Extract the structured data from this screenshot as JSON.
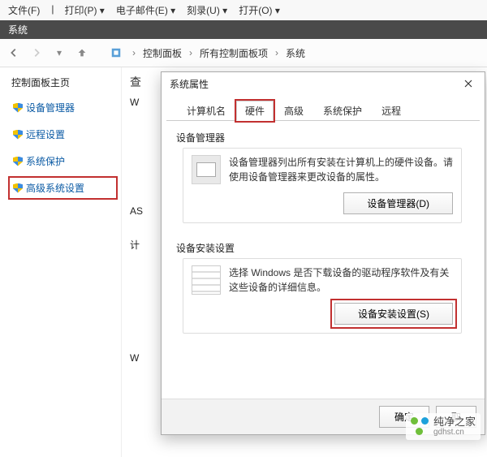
{
  "menubar": {
    "file": "文件(F)",
    "print": "打印(P)",
    "email": "电子邮件(E)",
    "burn": "刻录(U)",
    "open": "打开(O)"
  },
  "window": {
    "title": "系统"
  },
  "breadcrumb": {
    "root": "控制面板",
    "all": "所有控制面板项",
    "current": "系统"
  },
  "sidebar": {
    "title": "控制面板主页",
    "items": [
      {
        "label": "设备管理器"
      },
      {
        "label": "远程设置"
      },
      {
        "label": "系统保护"
      },
      {
        "label": "高级系统设置"
      }
    ]
  },
  "main": {
    "heading": "查",
    "stubs": [
      "W",
      "",
      "",
      "AS",
      "",
      "计",
      "",
      "W"
    ]
  },
  "dialog": {
    "title": "系统属性",
    "close": "×",
    "tabs": [
      {
        "label": "计算机名"
      },
      {
        "label": "硬件",
        "active": true,
        "highlight": true
      },
      {
        "label": "高级"
      },
      {
        "label": "系统保护"
      },
      {
        "label": "远程"
      }
    ],
    "groups": {
      "deviceManager": {
        "heading": "设备管理器",
        "desc": "设备管理器列出所有安装在计算机上的硬件设备。请使用设备管理器来更改设备的属性。",
        "button": "设备管理器(D)"
      },
      "installSettings": {
        "heading": "设备安装设置",
        "desc": "选择 Windows 是否下载设备的驱动程序软件及有关这些设备的详细信息。",
        "button": "设备安装设置(S)"
      }
    },
    "buttons": {
      "ok": "确定",
      "cancel": "取"
    }
  },
  "watermark": {
    "name": "纯净之家",
    "url": "gdhst.cn"
  }
}
